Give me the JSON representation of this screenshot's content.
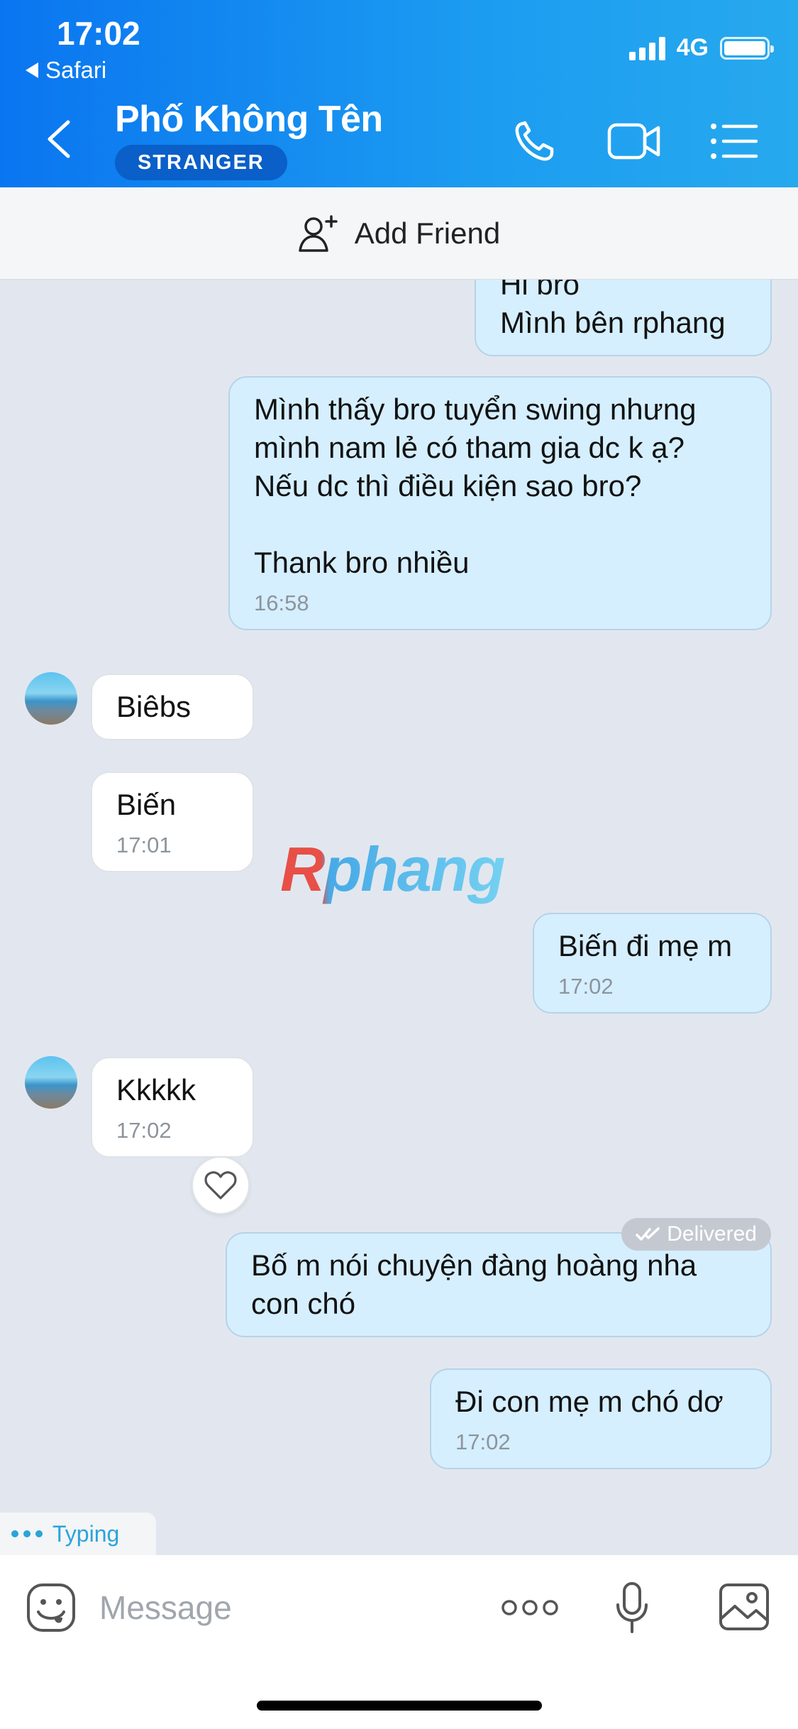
{
  "status_bar": {
    "time": "17:02",
    "back_app": "Safari",
    "network": "4G"
  },
  "header": {
    "contact_name": "Phố Không Tên",
    "badge": "STRANGER",
    "icons": [
      "chevron-left-icon",
      "phone-icon",
      "video-camera-icon",
      "list-menu-icon"
    ]
  },
  "add_friend": {
    "label": "Add Friend",
    "icon": "add-user-icon"
  },
  "messages": [
    {
      "dir": "out",
      "text": "Hi bro\nMình bên rphang",
      "time": ""
    },
    {
      "dir": "out",
      "text": "Mình thấy bro tuyển swing nhưng mình nam lẻ có tham gia dc k ạ?\nNếu dc thì điều kiện sao bro?\n\nThank bro nhiều",
      "time": "16:58"
    },
    {
      "dir": "in",
      "text": "Biêbs",
      "time": ""
    },
    {
      "dir": "in",
      "text": "Biến",
      "time": "17:01"
    },
    {
      "dir": "out",
      "text": "Biến đi mẹ m",
      "time": "17:02"
    },
    {
      "dir": "in",
      "text": "Kkkkk",
      "time": "17:02"
    },
    {
      "dir": "out",
      "text": "Bố m nói chuyện đàng hoàng nha con chó",
      "time": ""
    },
    {
      "dir": "out",
      "text": "Đi con mẹ m chó dơ",
      "time": "17:02"
    }
  ],
  "watermark": "Rphang",
  "delivered_label": "Delivered",
  "typing_label": "Typing",
  "composer": {
    "placeholder": "Message",
    "icons": [
      "emoji-icon",
      "more-icon",
      "microphone-icon",
      "image-icon"
    ]
  },
  "colors": {
    "header_start": "#0a75f0",
    "header_end": "#27a9ee",
    "outgoing_bubble": "#d5efff",
    "incoming_bubble": "#ffffff",
    "chat_background": "#e2e7ef",
    "typing_accent": "#2aa4d8"
  }
}
